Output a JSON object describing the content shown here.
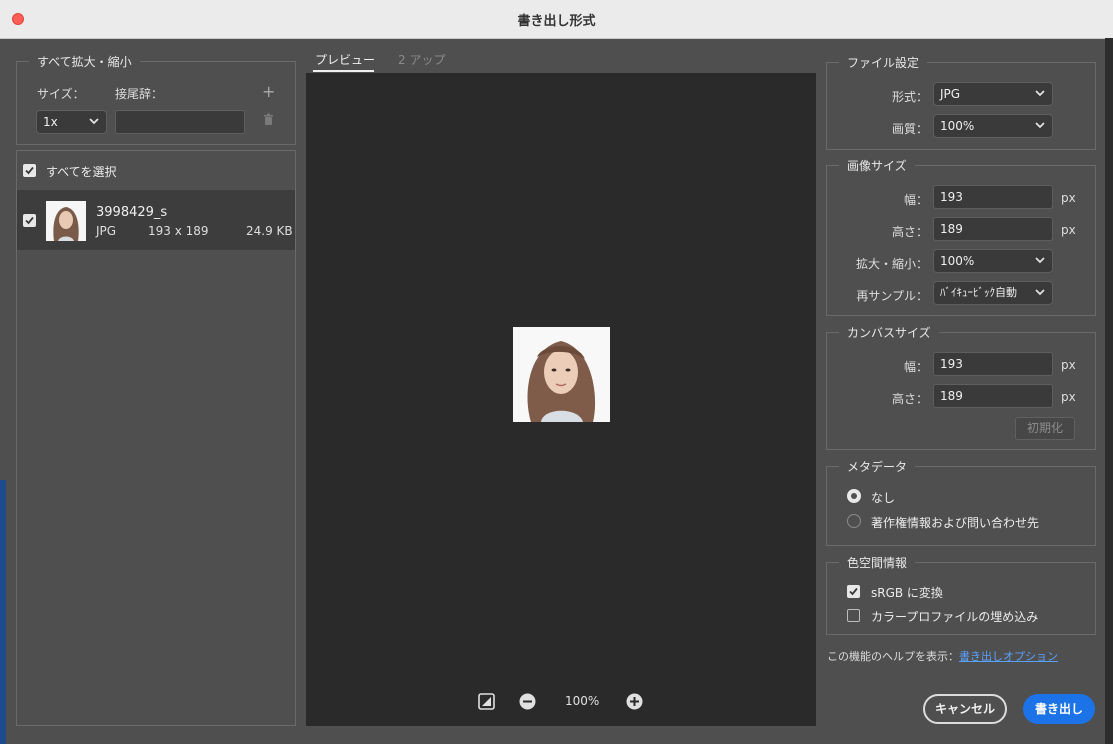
{
  "window": {
    "title": "書き出し形式"
  },
  "scale_all": {
    "title": "すべて拡大・縮小",
    "size_label": "サイズ：",
    "suffix_label": "接尾辞：",
    "size_value": "1x",
    "suffix_value": "",
    "add_icon": "plus-icon",
    "delete_icon": "trash-icon"
  },
  "asset_list": {
    "select_all_label": "すべてを選択",
    "select_all_checked": true,
    "items": [
      {
        "name": "3998429_s",
        "format": "JPG",
        "dimensions": "193 x 189",
        "filesize": "24.9 KB",
        "checked": true
      }
    ]
  },
  "preview": {
    "tabs": [
      {
        "label": "プレビュー",
        "active": true
      },
      {
        "label": "2 アップ",
        "active": false
      }
    ],
    "zoom": "100%"
  },
  "file_settings": {
    "title": "ファイル設定",
    "format_label": "形式：",
    "format_value": "JPG",
    "quality_label": "画質：",
    "quality_value": "100%"
  },
  "image_size": {
    "title": "画像サイズ",
    "width_label": "幅：",
    "width_value": "193",
    "height_label": "高さ：",
    "height_value": "189",
    "unit": "px",
    "scale_label": "拡大・縮小：",
    "scale_value": "100%",
    "resample_label": "再サンプル：",
    "resample_value": "ﾊﾞｲｷｭｰﾋﾞｯｸ自動"
  },
  "canvas_size": {
    "title": "カンバスサイズ",
    "width_label": "幅：",
    "width_value": "193",
    "height_label": "高さ：",
    "height_value": "189",
    "unit": "px",
    "reset_label": "初期化"
  },
  "metadata": {
    "title": "メタデータ",
    "options": [
      {
        "label": "なし",
        "selected": true
      },
      {
        "label": "著作権情報および問い合わせ先",
        "selected": false
      }
    ]
  },
  "color_space": {
    "title": "色空間情報",
    "convert_srgb_label": "sRGB に変換",
    "convert_srgb_checked": true,
    "embed_profile_label": "カラープロファイルの埋め込み",
    "embed_profile_checked": false
  },
  "help": {
    "prefix": "この機能のヘルプを表示：",
    "link_text": "書き出しオプション"
  },
  "actions": {
    "cancel_label": "キャンセル",
    "export_label": "書き出し"
  },
  "colors": {
    "primary_button": "#1c73e8",
    "close_button": "#ff5f57",
    "link": "#5aa2ff"
  }
}
